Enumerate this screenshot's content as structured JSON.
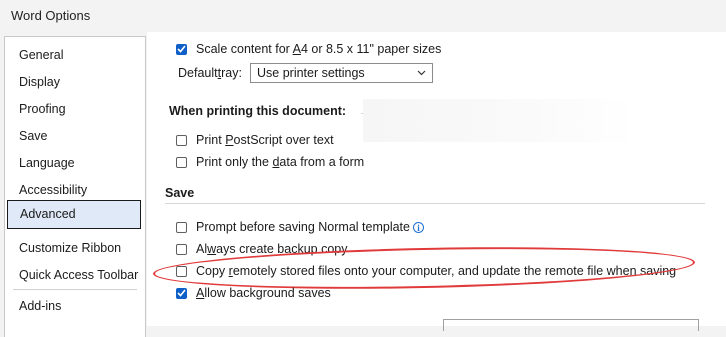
{
  "window": {
    "title": "Word Options"
  },
  "sidebar": {
    "items": [
      {
        "label": "General"
      },
      {
        "label": "Display"
      },
      {
        "label": "Proofing"
      },
      {
        "label": "Save"
      },
      {
        "label": "Language"
      },
      {
        "label": "Accessibility"
      },
      {
        "label": "Advanced",
        "active": true
      },
      {
        "label": "Customize Ribbon"
      },
      {
        "label": "Quick Access Toolbar"
      },
      {
        "label": "Add-ins"
      }
    ]
  },
  "print": {
    "scale_content": {
      "pre": "Scale content for ",
      "ul": "A",
      "post": "4 or 8.5 x 11\" paper sizes",
      "checked": true
    },
    "default_tray": {
      "pre": "Default ",
      "ul": "t",
      "post": "ray:",
      "value": "Use printer settings"
    }
  },
  "printing_doc": {
    "heading": "When printing this document:",
    "items": [
      {
        "pre": "Print ",
        "ul": "P",
        "post": "ostScript over text",
        "checked": false
      },
      {
        "pre": "Print only the ",
        "ul": "d",
        "post": "ata from a form",
        "checked": false
      }
    ]
  },
  "save": {
    "heading": "Save",
    "items": [
      {
        "pre": "Prompt before saving Normal template",
        "ul": "",
        "post": "",
        "checked": false,
        "info": "i"
      },
      {
        "pre": "Al",
        "ul": "w",
        "post": "ays create backup copy",
        "checked": false
      },
      {
        "pre": "Copy ",
        "ul": "r",
        "post": "emotely stored files onto your computer, and update the remote file when saving",
        "checked": false
      },
      {
        "pre": "",
        "ul": "A",
        "post": "llow background saves",
        "checked": true
      }
    ]
  },
  "colors": {
    "accent": "#0f5fc8",
    "annotation": "#e03a3a",
    "active_nav": "#dfe9f7"
  }
}
